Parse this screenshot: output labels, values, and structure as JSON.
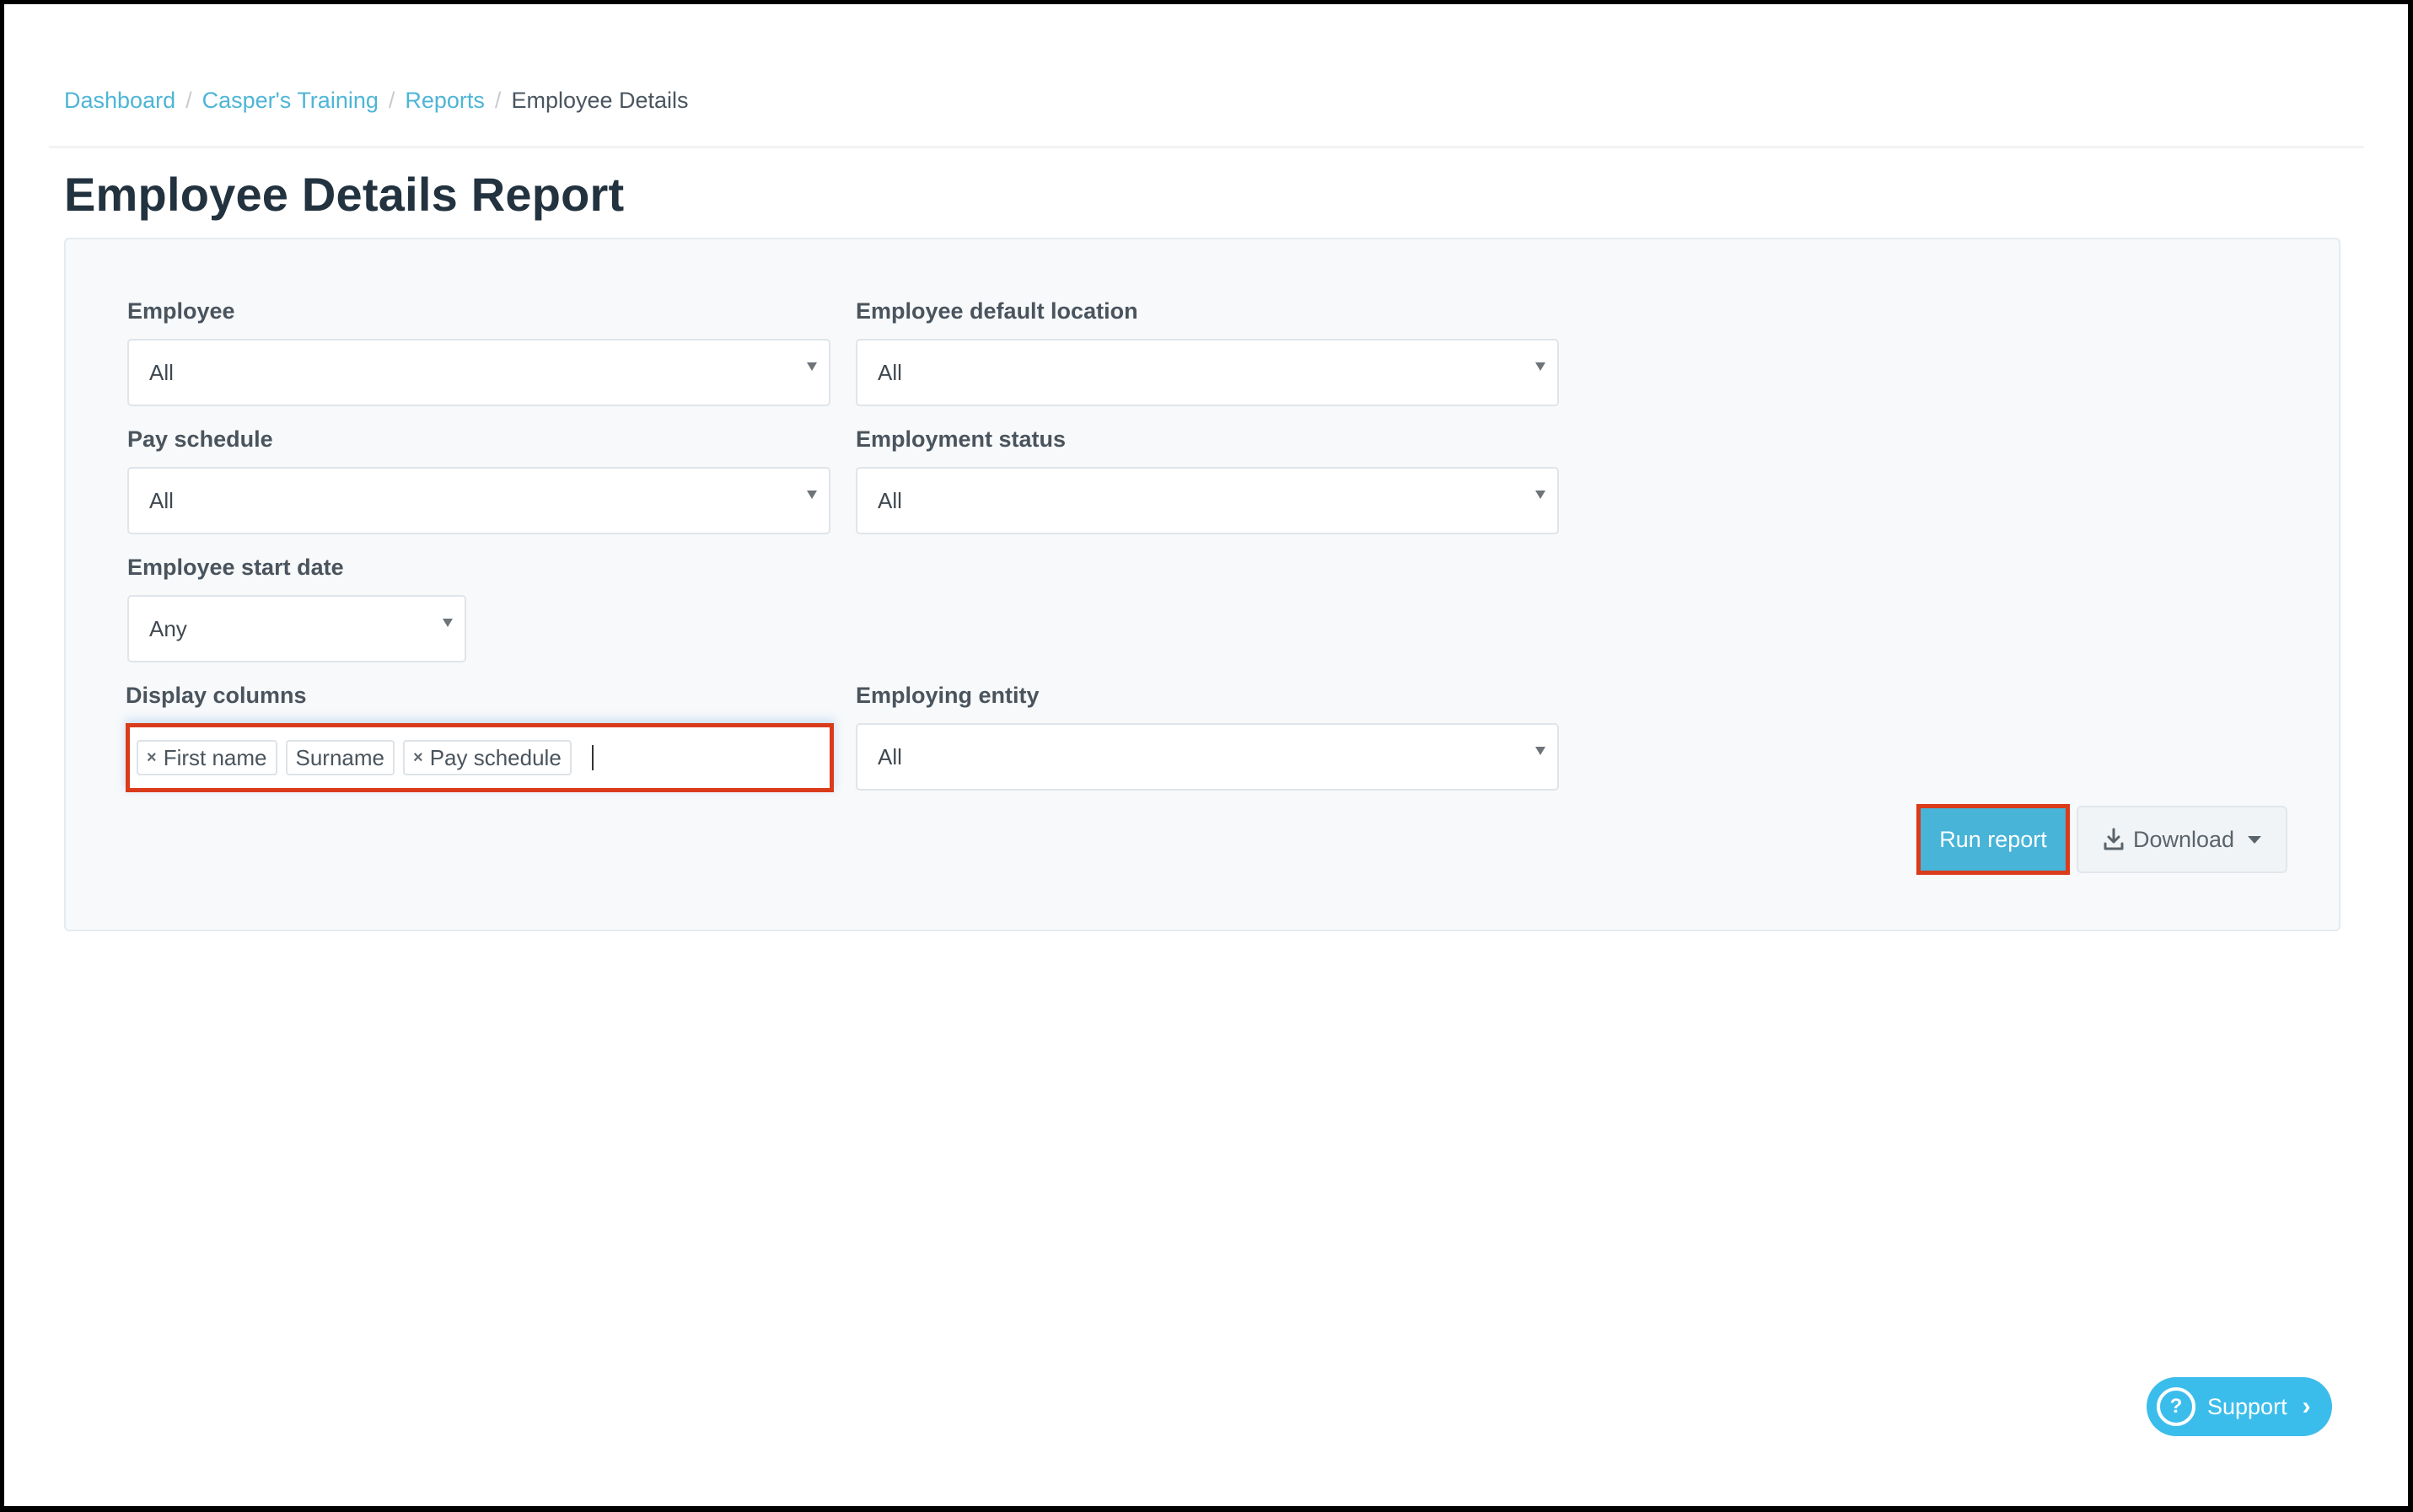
{
  "breadcrumb": {
    "items": [
      {
        "label": "Dashboard",
        "link": true
      },
      {
        "label": "Casper's Training",
        "link": true
      },
      {
        "label": "Reports",
        "link": true
      },
      {
        "label": "Employee Details",
        "link": false
      }
    ],
    "separator": "/"
  },
  "page": {
    "title": "Employee Details Report"
  },
  "filters": {
    "employee": {
      "label": "Employee",
      "value": "All"
    },
    "default_location": {
      "label": "Employee default location",
      "value": "All"
    },
    "pay_schedule": {
      "label": "Pay schedule",
      "value": "All"
    },
    "employment_status": {
      "label": "Employment status",
      "value": "All"
    },
    "start_date": {
      "label": "Employee start date",
      "value": "Any"
    },
    "display_columns": {
      "label": "Display columns",
      "tags": [
        {
          "label": "First name",
          "removable": true
        },
        {
          "label": "Surname",
          "removable": false
        },
        {
          "label": "Pay schedule",
          "removable": true
        }
      ],
      "remove_glyph": "×"
    },
    "employing_entity": {
      "label": "Employing entity",
      "value": "All"
    }
  },
  "actions": {
    "run_report": "Run report",
    "download": "Download",
    "download_icon": "download-icon"
  },
  "support": {
    "label": "Support",
    "icon": "question-circle-icon",
    "glyph": "?",
    "chevron": "›"
  },
  "colors": {
    "link": "#4eb5d6",
    "primary_button": "#47b4d8",
    "highlight_outline": "#d93b1b",
    "support": "#3bbdec",
    "title": "#22323f"
  }
}
